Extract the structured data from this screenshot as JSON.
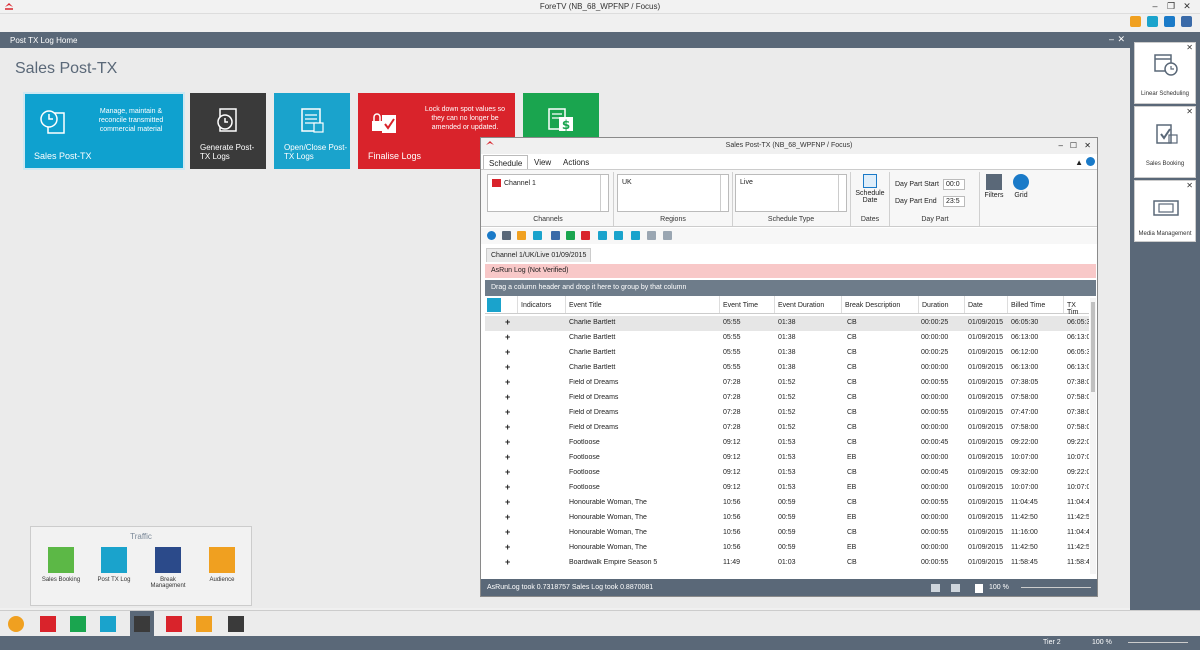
{
  "window": {
    "title": "ForeTV (NB_68_WPFNP / Focus)"
  },
  "main_tab": {
    "title": "Post TX Log Home"
  },
  "page": {
    "heading": "Sales Post-TX"
  },
  "tiles": [
    {
      "label": "Sales Post-TX",
      "desc": "Manage, maintain & reconcile transmitted commercial material",
      "color": "#0fa1cf",
      "icon": "clock-document-icon"
    },
    {
      "label": "Generate Post-TX Logs",
      "color": "#3a3a3a",
      "icon": "generate-logs-icon"
    },
    {
      "label": "Open/Close Post-TX Logs",
      "color": "#1aa3cc",
      "icon": "open-close-logs-icon"
    },
    {
      "label": "Finalise Logs",
      "desc": "Lock down spot values so they can no longer be amended or updated.",
      "color": "#d9232b",
      "icon": "lock-check-icon"
    },
    {
      "label": "",
      "color": "#1aa54f",
      "icon": "money-document-icon"
    }
  ],
  "right_panel": [
    {
      "label": "Linear Scheduling",
      "icon": "calendar-clock-icon"
    },
    {
      "label": "Sales Booking",
      "icon": "sales-booking-icon"
    },
    {
      "label": "Media Management",
      "icon": "film-icon"
    }
  ],
  "traffic": {
    "title": "Traffic",
    "items": [
      {
        "label": "Sales Booking",
        "color": "#5cb846",
        "icon": "sales-booking-icon"
      },
      {
        "label": "Post TX Log",
        "color": "#1aa3cc",
        "icon": "post-tx-log-icon"
      },
      {
        "label": "Break Management",
        "color": "#2b4a8a",
        "icon": "break-management-icon"
      },
      {
        "label": "Audience",
        "color": "#f0a020",
        "icon": "audience-icon"
      }
    ]
  },
  "statusbar": {
    "tier": "Tier 2",
    "zoom": "100 %"
  },
  "float_window": {
    "title": "Sales Post-TX (NB_68_WPFNP / Focus)",
    "menu": [
      "Schedule",
      "View",
      "Actions"
    ],
    "channels": {
      "value": "Channel 1",
      "group": "Channels"
    },
    "regions": {
      "value": "UK",
      "group": "Regions"
    },
    "schedule_type": {
      "value": "Live",
      "group": "Schedule Type"
    },
    "dates": {
      "button": "Schedule Date",
      "group": "Dates"
    },
    "day_part": {
      "start_label": "Day Part Start",
      "start_value": "00:0",
      "end_label": "Day Part End",
      "end_value": "23:5",
      "group": "Day Part"
    },
    "filters_label": "Filters",
    "grid_label": "Grid",
    "doc_tab": "Channel 1/UK/Live 01/09/2015",
    "asrun": "AsRun Log (Not Verified)",
    "group_hint": "Drag a column header and drop it here to group by that column",
    "columns": [
      "Indicators",
      "Event Title",
      "Event Time",
      "Event Duration",
      "Break Description",
      "Duration",
      "Date",
      "Billed Time",
      "TX Tim"
    ],
    "rows": [
      [
        "+",
        "Charlie Bartlett",
        "05:55",
        "01:38",
        "CB",
        "00:00:25",
        "01/09/2015",
        "06:05:30",
        "06:05:3"
      ],
      [
        "+",
        "Charlie Bartlett",
        "05:55",
        "01:38",
        "CB",
        "00:00:00",
        "01/09/2015",
        "06:13:00",
        "06:13:0"
      ],
      [
        "+",
        "Charlie Bartlett",
        "05:55",
        "01:38",
        "CB",
        "00:00:25",
        "01/09/2015",
        "06:12:00",
        "06:05:3"
      ],
      [
        "+",
        "Charlie Bartlett",
        "05:55",
        "01:38",
        "CB",
        "00:00:00",
        "01/09/2015",
        "06:13:00",
        "06:13:0"
      ],
      [
        "+",
        "Field of Dreams",
        "07:28",
        "01:52",
        "CB",
        "00:00:55",
        "01/09/2015",
        "07:38:05",
        "07:38:0"
      ],
      [
        "+",
        "Field of Dreams",
        "07:28",
        "01:52",
        "CB",
        "00:00:00",
        "01/09/2015",
        "07:58:00",
        "07:58:0"
      ],
      [
        "+",
        "Field of Dreams",
        "07:28",
        "01:52",
        "CB",
        "00:00:55",
        "01/09/2015",
        "07:47:00",
        "07:38:0"
      ],
      [
        "+",
        "Field of Dreams",
        "07:28",
        "01:52",
        "CB",
        "00:00:00",
        "01/09/2015",
        "07:58:00",
        "07:58:0"
      ],
      [
        "+",
        "Footloose",
        "09:12",
        "01:53",
        "CB",
        "00:00:45",
        "01/09/2015",
        "09:22:00",
        "09:22:0"
      ],
      [
        "+",
        "Footloose",
        "09:12",
        "01:53",
        "EB",
        "00:00:00",
        "01/09/2015",
        "10:07:00",
        "10:07:0"
      ],
      [
        "+",
        "Footloose",
        "09:12",
        "01:53",
        "CB",
        "00:00:45",
        "01/09/2015",
        "09:32:00",
        "09:22:0"
      ],
      [
        "+",
        "Footloose",
        "09:12",
        "01:53",
        "EB",
        "00:00:00",
        "01/09/2015",
        "10:07:00",
        "10:07:0"
      ],
      [
        "+",
        "Honourable Woman, The",
        "10:56",
        "00:59",
        "CB",
        "00:00:55",
        "01/09/2015",
        "11:04:45",
        "11:04:4"
      ],
      [
        "+",
        "Honourable Woman, The",
        "10:56",
        "00:59",
        "EB",
        "00:00:00",
        "01/09/2015",
        "11:42:50",
        "11:42:5"
      ],
      [
        "+",
        "Honourable Woman, The",
        "10:56",
        "00:59",
        "CB",
        "00:00:55",
        "01/09/2015",
        "11:16:00",
        "11:04:4"
      ],
      [
        "+",
        "Honourable Woman, The",
        "10:56",
        "00:59",
        "EB",
        "00:00:00",
        "01/09/2015",
        "11:42:50",
        "11:42:5"
      ],
      [
        "+",
        "Boardwalk Empire Season 5",
        "11:49",
        "01:03",
        "CB",
        "00:00:55",
        "01/09/2015",
        "11:58:45",
        "11:58:4"
      ]
    ],
    "status": "AsRunLog took 0.7318757 Sales Log took 0.8870081",
    "zoom": "100 %"
  }
}
